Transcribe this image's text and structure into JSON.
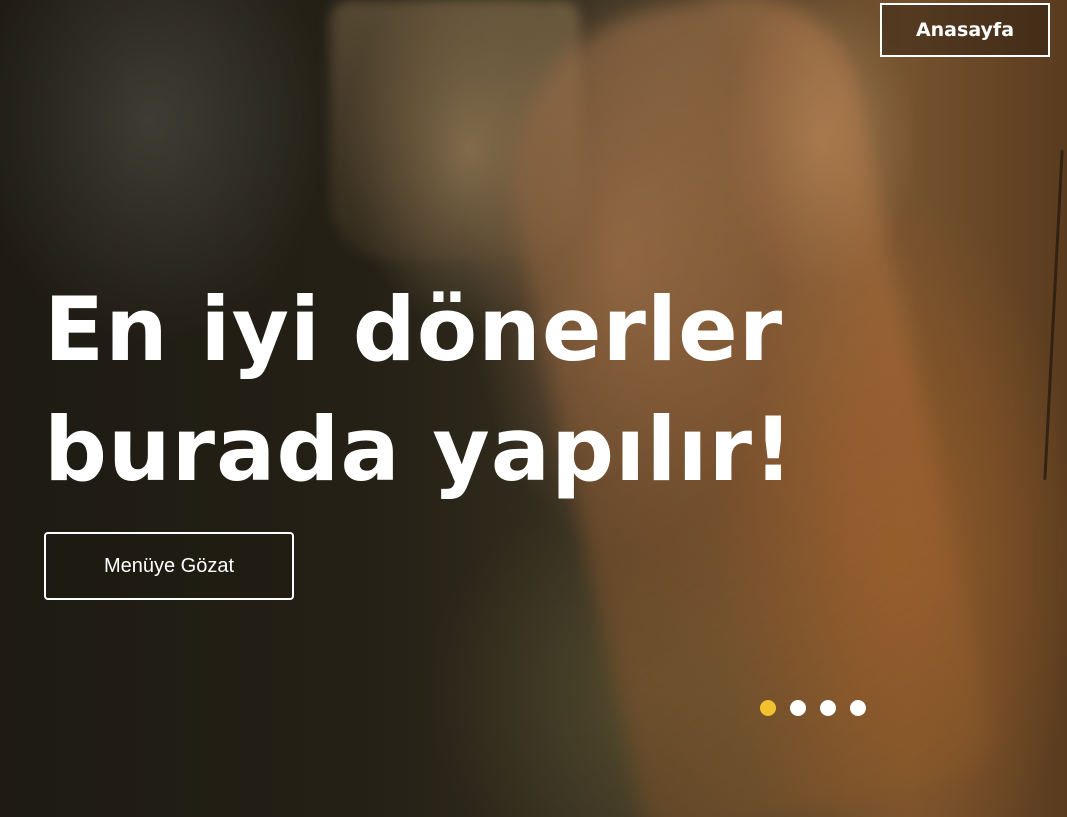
{
  "nav": {
    "home_label": "Anasayfa"
  },
  "hero": {
    "headline": "En iyi dönerler burada yapılır!",
    "cta_label": "Menüye Gözat"
  },
  "slider": {
    "total_slides": 4,
    "active_slide": 1,
    "active_color": "#f2c12e",
    "inactive_color": "#ffffff"
  }
}
